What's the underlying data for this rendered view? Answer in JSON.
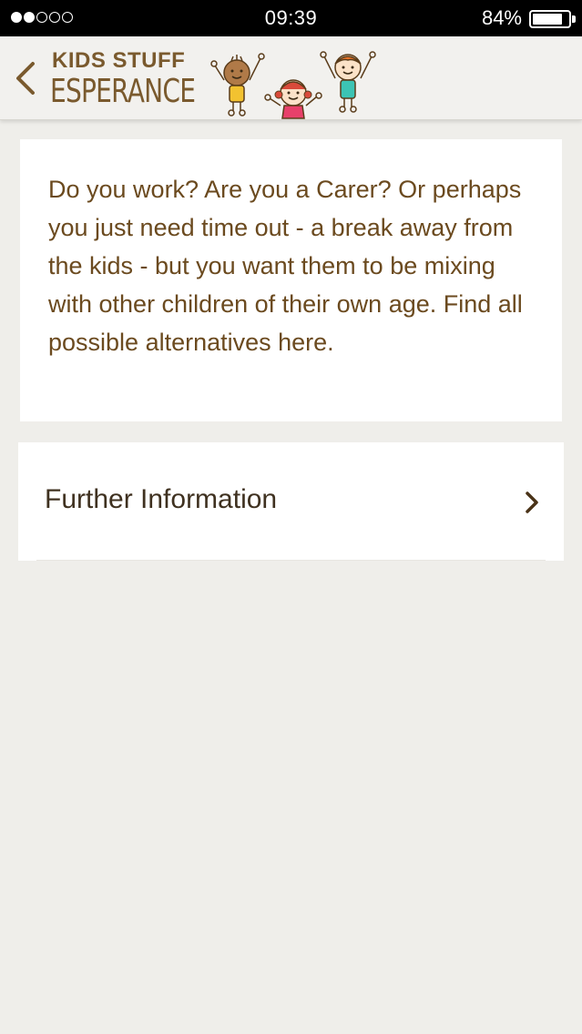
{
  "status_bar": {
    "signal_dots_filled": 2,
    "signal_dots_total": 5,
    "time": "09:39",
    "battery_percent_label": "84%",
    "battery_level": 0.84
  },
  "header": {
    "back_icon": "chevron-left-icon",
    "logo_line1": "KIDS STUFF",
    "logo_line2": "ESPERANCE",
    "logo_art": "cartoon-kids-illustration",
    "brand_color": "#7a5a2e"
  },
  "intro": {
    "text": "Do you work? Are you a Carer? Or perhaps you just need time out - a break away from the kids - but you want them to be mixing with other children of their own age. Find all possible alternatives here."
  },
  "links": [
    {
      "label": "Further Information",
      "icon": "chevron-right-icon"
    }
  ],
  "colors": {
    "background": "#efeeea",
    "card": "#ffffff",
    "text_brown": "#6b4a1f"
  }
}
